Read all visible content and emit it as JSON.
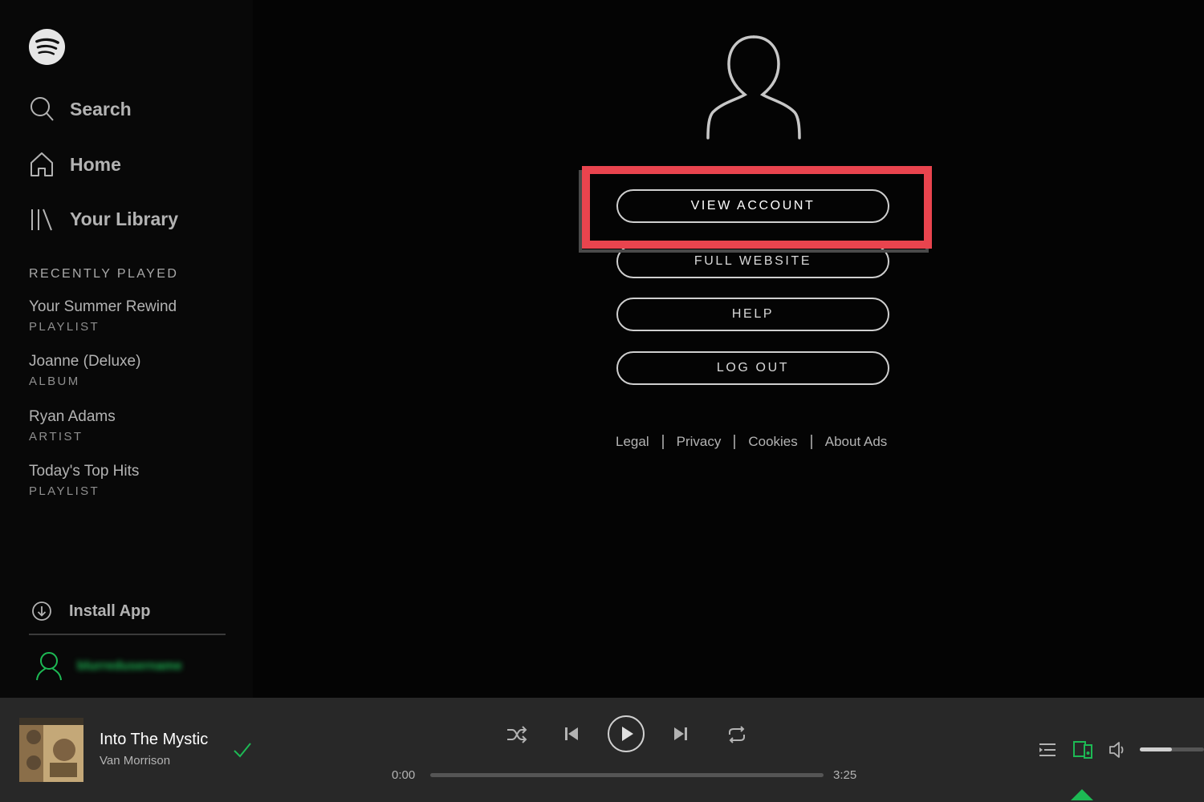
{
  "sidebar": {
    "nav": [
      {
        "label": "Search",
        "icon": "search-icon"
      },
      {
        "label": "Home",
        "icon": "home-icon"
      },
      {
        "label": "Your Library",
        "icon": "library-icon"
      }
    ],
    "recently_played_heading": "RECENTLY PLAYED",
    "recently_played": [
      {
        "title": "Your Summer Rewind",
        "type": "PLAYLIST"
      },
      {
        "title": "Joanne (Deluxe)",
        "type": "ALBUM"
      },
      {
        "title": "Ryan Adams",
        "type": "ARTIST"
      },
      {
        "title": "Today's Top Hits",
        "type": "PLAYLIST"
      }
    ],
    "install_app_label": "Install App",
    "username": "blurredusername"
  },
  "main": {
    "menu": {
      "view_account": "VIEW ACCOUNT",
      "full_website": "FULL WEBSITE",
      "help": "HELP",
      "log_out": "LOG OUT"
    },
    "footer_links": [
      "Legal",
      "Privacy",
      "Cookies",
      "About Ads"
    ]
  },
  "player": {
    "track_title": "Into The Mystic",
    "track_artist": "Van Morrison",
    "elapsed": "0:00",
    "duration": "3:25",
    "progress_fraction": 0.0,
    "volume_fraction": 0.5
  },
  "colors": {
    "accent": "#1db954",
    "highlight": "#e9444e",
    "background": "#040404",
    "player_bg": "#282828"
  }
}
